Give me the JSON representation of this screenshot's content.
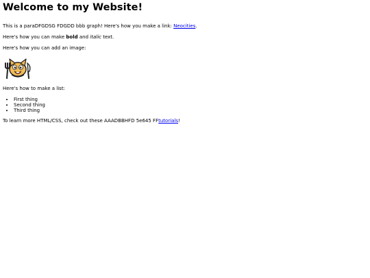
{
  "page": {
    "title": "Welcome to my Website!",
    "paragraph1": {
      "text": "This is a paraDFGDSG FDGDD bbb graph! Here's how you make a link: ",
      "link_text": "Neocities",
      "suffix": "."
    },
    "paragraph2": {
      "prefix": "Here's how you can make ",
      "bold": "bold",
      "middle": " and ",
      "italic": "italic",
      "suffix": " text."
    },
    "paragraph3": {
      "text": "Here's how you can add an image:"
    },
    "image": {
      "icon": "neocities-cat-icon"
    },
    "paragraph4": {
      "text": "Here's how to make a list:"
    },
    "list": [
      "First thing",
      "Second thing",
      "Third thing"
    ],
    "paragraph5": {
      "text": "To learn more HTML/CSS, check out these AAADBBHFD 5e645 FF",
      "link_text": "tutorials",
      "suffix": "!"
    }
  },
  "colors": {
    "link": "#0000ee",
    "text": "#000000",
    "background": "#ffffff"
  }
}
